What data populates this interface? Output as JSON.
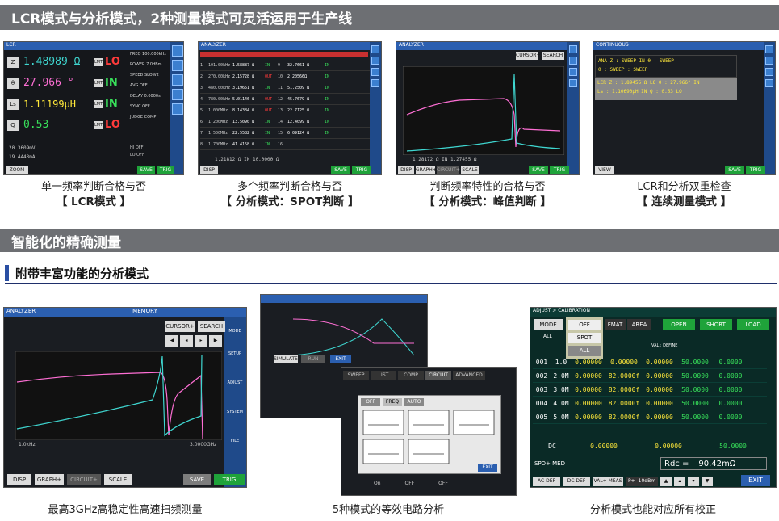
{
  "section1": {
    "title": "LCR模式与分析模式，2种测量模式可灵活运用于生产线"
  },
  "section2": {
    "title": "智能化的精确测量"
  },
  "subsection": {
    "title": "附带丰富功能的分析模式"
  },
  "captions_top": [
    {
      "line1": "单一频率判断合格与否",
      "line2": "【 LCR模式 】"
    },
    {
      "line1": "多个频率判断合格与否",
      "line2": "【 分析模式：SPOT判断 】"
    },
    {
      "line1": "判断频率特性的合格与否",
      "line2": "【 分析模式：峰值判断 】"
    },
    {
      "line1": "LCR和分析双重检查",
      "line2": "【 连续测量模式 】"
    }
  ],
  "captions_bottom": [
    {
      "line1": "最高3GHz高稳定性高速扫频测量"
    },
    {
      "line1": "5种模式的等效电路分析"
    },
    {
      "line1": "分析模式也能对应所有校正"
    }
  ],
  "lcr": {
    "title": "LCR",
    "rows": [
      {
        "param": "Z",
        "value": "1.48989 Ω",
        "judge": "LO",
        "color": "#3fd6d0",
        "judge_color": "#ff3b3b"
      },
      {
        "param": "θ",
        "value": "27.966 °",
        "judge": "IN",
        "color": "#ff6fd5",
        "judge_color": "#38e05a"
      },
      {
        "param": "Ls",
        "value": "1.11199μH",
        "judge": "IN",
        "color": "#ffe83a",
        "judge_color": "#38e05a"
      },
      {
        "param": "Q",
        "value": "0.53",
        "judge": "LO",
        "color": "#38e05a",
        "judge_color": "#ff3b3b"
      }
    ],
    "lmt": "LMT",
    "settings": [
      {
        "k": "FREQ",
        "v": "100.000kHz"
      },
      {
        "k": "POWER",
        "v": "7.0dBm"
      },
      {
        "k": "SPEED",
        "v": "SLOW2"
      },
      {
        "k": "AVG",
        "v": "OFF"
      },
      {
        "k": "DELAY",
        "v": "0.0000s"
      },
      {
        "k": "SYNC",
        "v": "OFF"
      },
      {
        "k": "JUDGE",
        "v": "COMP"
      }
    ],
    "monitor": [
      "20.3609mV",
      "19.4443mA"
    ],
    "hi": "HI OFF",
    "lo": "LO OFF",
    "zoom_off": "ZOOM OFF",
    "save": "SAVE",
    "trig": "TRIG"
  },
  "spot": {
    "title": "ANALYZER",
    "rows": [
      {
        "no": "1",
        "freq": "101.00kHz",
        "value": "1.58887 Ω",
        "j": "IN",
        "no2": "9",
        "value2": "32.7661 Ω",
        "j2": "IN"
      },
      {
        "no": "2",
        "freq": "270.00kHz",
        "value": "2.15728 Ω",
        "j": "OUT",
        "no2": "10",
        "value2": "2.20566Ω",
        "j2": "IN"
      },
      {
        "no": "3",
        "freq": "480.00kHz",
        "value": "3.19651 Ω",
        "j": "IN",
        "no2": "11",
        "value2": "51.2509 Ω",
        "j2": "IN"
      },
      {
        "no": "4",
        "freq": "780.00kHz",
        "value": "5.01146 Ω",
        "j": "OUT",
        "no2": "12",
        "value2": "45.7679 Ω",
        "j2": "IN"
      },
      {
        "no": "5",
        "freq": "1.000MHz",
        "value": "8.14384 Ω",
        "j": "OUT",
        "no2": "13",
        "value2": "22.7125 Ω",
        "j2": "IN"
      },
      {
        "no": "6",
        "freq": "1.200MHz",
        "value": "13.5090 Ω",
        "j": "IN",
        "no2": "14",
        "value2": "12.4099 Ω",
        "j2": "IN"
      },
      {
        "no": "7",
        "freq": "1.500MHz",
        "value": "22.5582 Ω",
        "j": "IN",
        "no2": "15",
        "value2": "6.09124 Ω",
        "j2": "IN"
      },
      {
        "no": "8",
        "freq": "1.700MHz",
        "value": "41.4158 Ω",
        "j": "IN",
        "no2": "16",
        "value2": "",
        "j2": ""
      }
    ],
    "footer": "1.21812 Ω  IN  10.0000 Ω",
    "disp": "DISP",
    "save": "SAVE",
    "trig": "TRIG"
  },
  "peak": {
    "title": "ANALYZER",
    "cursor": "CURSOR+",
    "search": "SEARCH",
    "footer": "1.28172 Ω  IN  1.27455 Ω",
    "disp": "DISP",
    "graph": "GRAPH+",
    "circuit": "CIRCUIT+",
    "scale": "SCALE",
    "save": "SAVE",
    "trig": "TRIG"
  },
  "cont": {
    "title": "CONTINUOUS",
    "line1": "ANA  Z : SWEEP  IN  θ : SWEEP",
    "line2": "θ : SWEEP        : SWEEP",
    "line3": "LCR  Z : 1.89455 Ω  LO  θ : 27.966°  IN",
    "line4": "Ls : 1.10690μH  IN  Q : 0.53  LO",
    "view": "VIEW",
    "save": "SAVE",
    "trig": "TRIG"
  },
  "big": {
    "title": "ANALYZER",
    "memory": "MEMORY",
    "cursor": "CURSOR+",
    "search": "SEARCH",
    "start": "1.0kHz",
    "stop": "3.0000GHz",
    "disp": "DISP",
    "graph": "GRAPH+",
    "circuit": "CIRCUIT+",
    "scale": "SCALE",
    "save": "SAVE",
    "trig": "TRIG",
    "side": [
      "MODE",
      "SETUP",
      "ADJUST",
      "SYSTEM",
      "FILE"
    ]
  },
  "circ": {
    "simulate": "SIMULATE",
    "run": "RUN",
    "exit": "EXIT",
    "tabs": [
      "SWEEP",
      "LIST",
      "COMP",
      "CIRCUIT",
      "ADVANCED"
    ],
    "modes": [
      "OFF",
      "FREQ",
      "AUTO"
    ],
    "exit2": "EXIT",
    "bottom": [
      "On",
      "OFF",
      "OFF"
    ],
    "models": [
      "A",
      "B",
      "C",
      "D",
      "E"
    ]
  },
  "cal": {
    "title": "ADJUST > CALIBRATION",
    "mode": "MODE",
    "all": "ALL",
    "dropdown": [
      "OFF",
      "SPOT",
      "ALL"
    ],
    "format": "FMAT",
    "area": "AREA",
    "open": "OPEN",
    "short": "SHORT",
    "load": "LOAD",
    "val_define": "VAL : DEFINE",
    "rows": [
      {
        "no": "001",
        "freq": "1.0",
        "c1": "0.00000",
        "c2": "0.00000",
        "c3": "0.00000",
        "c4": "50.0000",
        "c5": "0.0000"
      },
      {
        "no": "002",
        "freq": "2.0M",
        "c1": "0.00000",
        "c2": "82.0000f",
        "c3": "0.00000",
        "c4": "50.0000",
        "c5": "0.0000"
      },
      {
        "no": "003",
        "freq": "3.0M",
        "c1": "0.00000",
        "c2": "82.0000f",
        "c3": "0.00000",
        "c4": "50.0000",
        "c5": "0.0000"
      },
      {
        "no": "004",
        "freq": "4.0M",
        "c1": "0.00000",
        "c2": "82.0000f",
        "c3": "0.00000",
        "c4": "50.0000",
        "c5": "0.0000"
      },
      {
        "no": "005",
        "freq": "5.0M",
        "c1": "0.00000",
        "c2": "82.0000f",
        "c3": "0.00000",
        "c4": "50.0000",
        "c5": "0.0000"
      }
    ],
    "dc": "DC",
    "dc_vals": [
      "0.00000",
      "0.00000",
      "50.0000"
    ],
    "rdc_label": "Rdc =",
    "rdc_value": "90.42mΩ",
    "spd": "SPD+ MED",
    "bottom": [
      "AC DEF",
      "DC DEF",
      "VAL+ MEAS",
      "P+ -10dBm"
    ],
    "exit": "EXIT"
  }
}
